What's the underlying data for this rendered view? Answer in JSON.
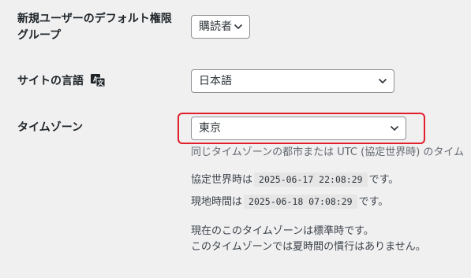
{
  "settings": {
    "default_role": {
      "label_line1": "新規ユーザーのデフォルト権限",
      "label_line2": "グループ",
      "value": "購読者"
    },
    "site_language": {
      "label": "サイトの言語",
      "icon": "translate-icon",
      "value": "日本語"
    },
    "timezone": {
      "label": "タイムゾーン",
      "value": "東京",
      "help": "同じタイムゾーンの都市または UTC (協定世界時) のタイム",
      "utc_label": "協定世界時は",
      "utc_time": "2025-06-17 22:08:29",
      "utc_suffix": "です。",
      "local_label": "現地時間は",
      "local_time": "2025-06-18 07:08:29",
      "local_suffix": "です。",
      "dst_line1": "現在のこのタイムゾーンは標準時です。",
      "dst_line2": "このタイムゾーンでは夏時間の慣行はありません。"
    }
  },
  "colors": {
    "highlight": "#e0202a",
    "background": "#f0f0f1"
  }
}
